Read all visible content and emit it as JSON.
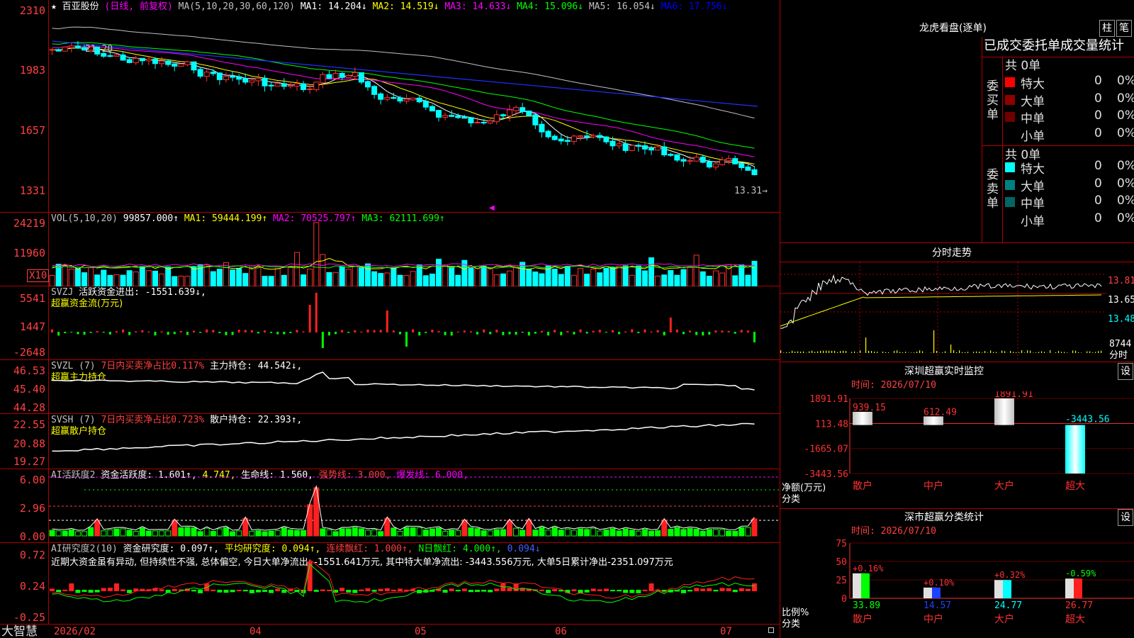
{
  "stock": {
    "star": "★",
    "name": "百亚股份",
    "mode": "(日线, 前复权)",
    "ma_label": "MA(5,10,20,30,60,120)",
    "ma": [
      {
        "name": "MA1:",
        "value": "14.204↓",
        "color": "#ffffff"
      },
      {
        "name": "MA2:",
        "value": "14.519↓",
        "color": "#ffff00"
      },
      {
        "name": "MA3:",
        "value": "14.633↓",
        "color": "#ff00ff"
      },
      {
        "name": "MA4:",
        "value": "15.096↓",
        "color": "#00ff00"
      },
      {
        "name": "MA5:",
        "value": "16.054↓",
        "color": "#c0c0c0"
      },
      {
        "name": "MA6:",
        "value": "17.756↓",
        "color": "#0000ff"
      }
    ],
    "price_axis": [
      "2310",
      "1983",
      "1657",
      "1331"
    ],
    "high_label": "21.20",
    "last_label": "13.31→",
    "colors": {
      "up": "#ff3030",
      "down": "#00ffff",
      "frame": "#b00000",
      "axis": "#ff4040"
    }
  },
  "vol": {
    "label": "VOL(5,10,20)",
    "value": "99857.000↑",
    "ma": [
      {
        "name": "MA1:",
        "value": "59444.199↑",
        "color": "#ffff00"
      },
      {
        "name": "MA2:",
        "value": "70525.797↑",
        "color": "#ff00ff"
      },
      {
        "name": "MA3:",
        "value": "62111.699↑",
        "color": "#00ff00"
      }
    ],
    "axis": [
      "24219",
      "11960"
    ],
    "unit": "X10"
  },
  "svzj": {
    "label": "SVZJ",
    "line1": "活跃资金进出: -1551.639↓,",
    "line2": "超赢资金流(万元)",
    "axis": [
      "5541",
      "1447",
      "-2648"
    ]
  },
  "svzl": {
    "label": "SVZL (7)",
    "p1": "7日内买卖净占比0.117%",
    "p2": "主力持仓: 44.542↓,",
    "line2": "超赢主力持仓",
    "axis": [
      "46.53",
      "45.40",
      "44.28"
    ]
  },
  "svsh": {
    "label": "SVSH (7)",
    "p1": "7日内买卖净占比0.723%",
    "p2": "散户持仓: 22.393↑,",
    "line2": "超赢散户持仓",
    "axis": [
      "22.55",
      "20.88",
      "19.27"
    ]
  },
  "ai1": {
    "label": "AI活跃度2",
    "p1": "资金活跃度: 1.601↑,",
    "p2": "4.747,",
    "p3": "生命线: 1.560,",
    "p4": "强势线: 3.000,",
    "p5": "爆发线: 6.000,",
    "axis": [
      "6.00",
      "2.96",
      "0.00"
    ]
  },
  "ai2": {
    "label": "AI研究度2(10)",
    "p1": "资金研究度: 0.097↑,",
    "p2": "平均研究度: 0.094↑,",
    "p3": "连续飘红: 1.000↑,",
    "p4": "N日飘红: 4.000↑,",
    "p5": "0.094↓",
    "note": "近期大资金虽有异动, 但持续性不强, 总体偏空, 今日大单净流出: -1551.641万元, 其中特大单净流出: -3443.556万元, 大单5日累计净出-2351.097万元",
    "axis": [
      "0.72",
      "0.24",
      "-0.25"
    ]
  },
  "xaxis": {
    "brand": "大智慧",
    "labels": [
      "2026/02",
      "04",
      "05",
      "06",
      "07"
    ]
  },
  "longhu": {
    "title": "龙虎看盘(逐单)",
    "btn1": "柱",
    "btn2": "笔",
    "header": "已成交委托单成交量统计",
    "buy_side": "委买单",
    "sell_side": "委卖单",
    "buy_total": "共 0单",
    "sell_total": "共 0单",
    "buy_rows": [
      {
        "name": "特大",
        "count": "0",
        "pct": "0%",
        "color": "#ff0000"
      },
      {
        "name": "大单",
        "count": "0",
        "pct": "0%",
        "color": "#900000"
      },
      {
        "name": "中单",
        "count": "0",
        "pct": "0%",
        "color": "#700000"
      },
      {
        "name": "小单",
        "count": "0",
        "pct": "0%",
        "color": ""
      }
    ],
    "sell_rows": [
      {
        "name": "特大",
        "count": "0",
        "pct": "0%",
        "color": "#00ffff"
      },
      {
        "name": "大单",
        "count": "0",
        "pct": "0%",
        "color": "#008080"
      },
      {
        "name": "中单",
        "count": "0",
        "pct": "0%",
        "color": "#006666"
      },
      {
        "name": "小单",
        "count": "0",
        "pct": "0%",
        "color": ""
      }
    ]
  },
  "intraday": {
    "title": "分时走势",
    "axis": [
      "13.81",
      "13.65",
      "13.48"
    ],
    "vol_label": "8744",
    "unit": "分时"
  },
  "monitor": {
    "title": "深圳超赢实时监控",
    "set": "设",
    "time": "时间: 2026/07/10",
    "ylabels": [
      "1891.91",
      "113.48",
      "-1665.07",
      "-3443.56"
    ],
    "y_title": "净额(万元)",
    "x_title": "分类",
    "categories": [
      "散户",
      "中户",
      "大户",
      "超大"
    ],
    "values": [
      "939.15",
      "612.49",
      "1891.91",
      "-3443.56"
    ],
    "nums": [
      939.15,
      612.49,
      1891.91,
      -3443.56
    ]
  },
  "classify": {
    "title": "深市超赢分类统计",
    "set": "设",
    "time": "时间: 2026/07/10",
    "ylabels": [
      "75",
      "50",
      "25",
      "0"
    ],
    "y_title": "比例%",
    "x_title": "分类",
    "categories": [
      "散户",
      "中户",
      "大户",
      "超大"
    ],
    "pcts": [
      "+0.16%",
      "+0.10%",
      "+0.32%",
      "-0.59%"
    ],
    "values": [
      "33.89",
      "14.57",
      "24.77",
      "26.77"
    ],
    "nums": [
      33.89,
      14.57,
      24.77,
      26.77
    ],
    "colors": [
      "#00ff00",
      "#2040ff",
      "#00ffff",
      "#ff2020"
    ]
  }
}
